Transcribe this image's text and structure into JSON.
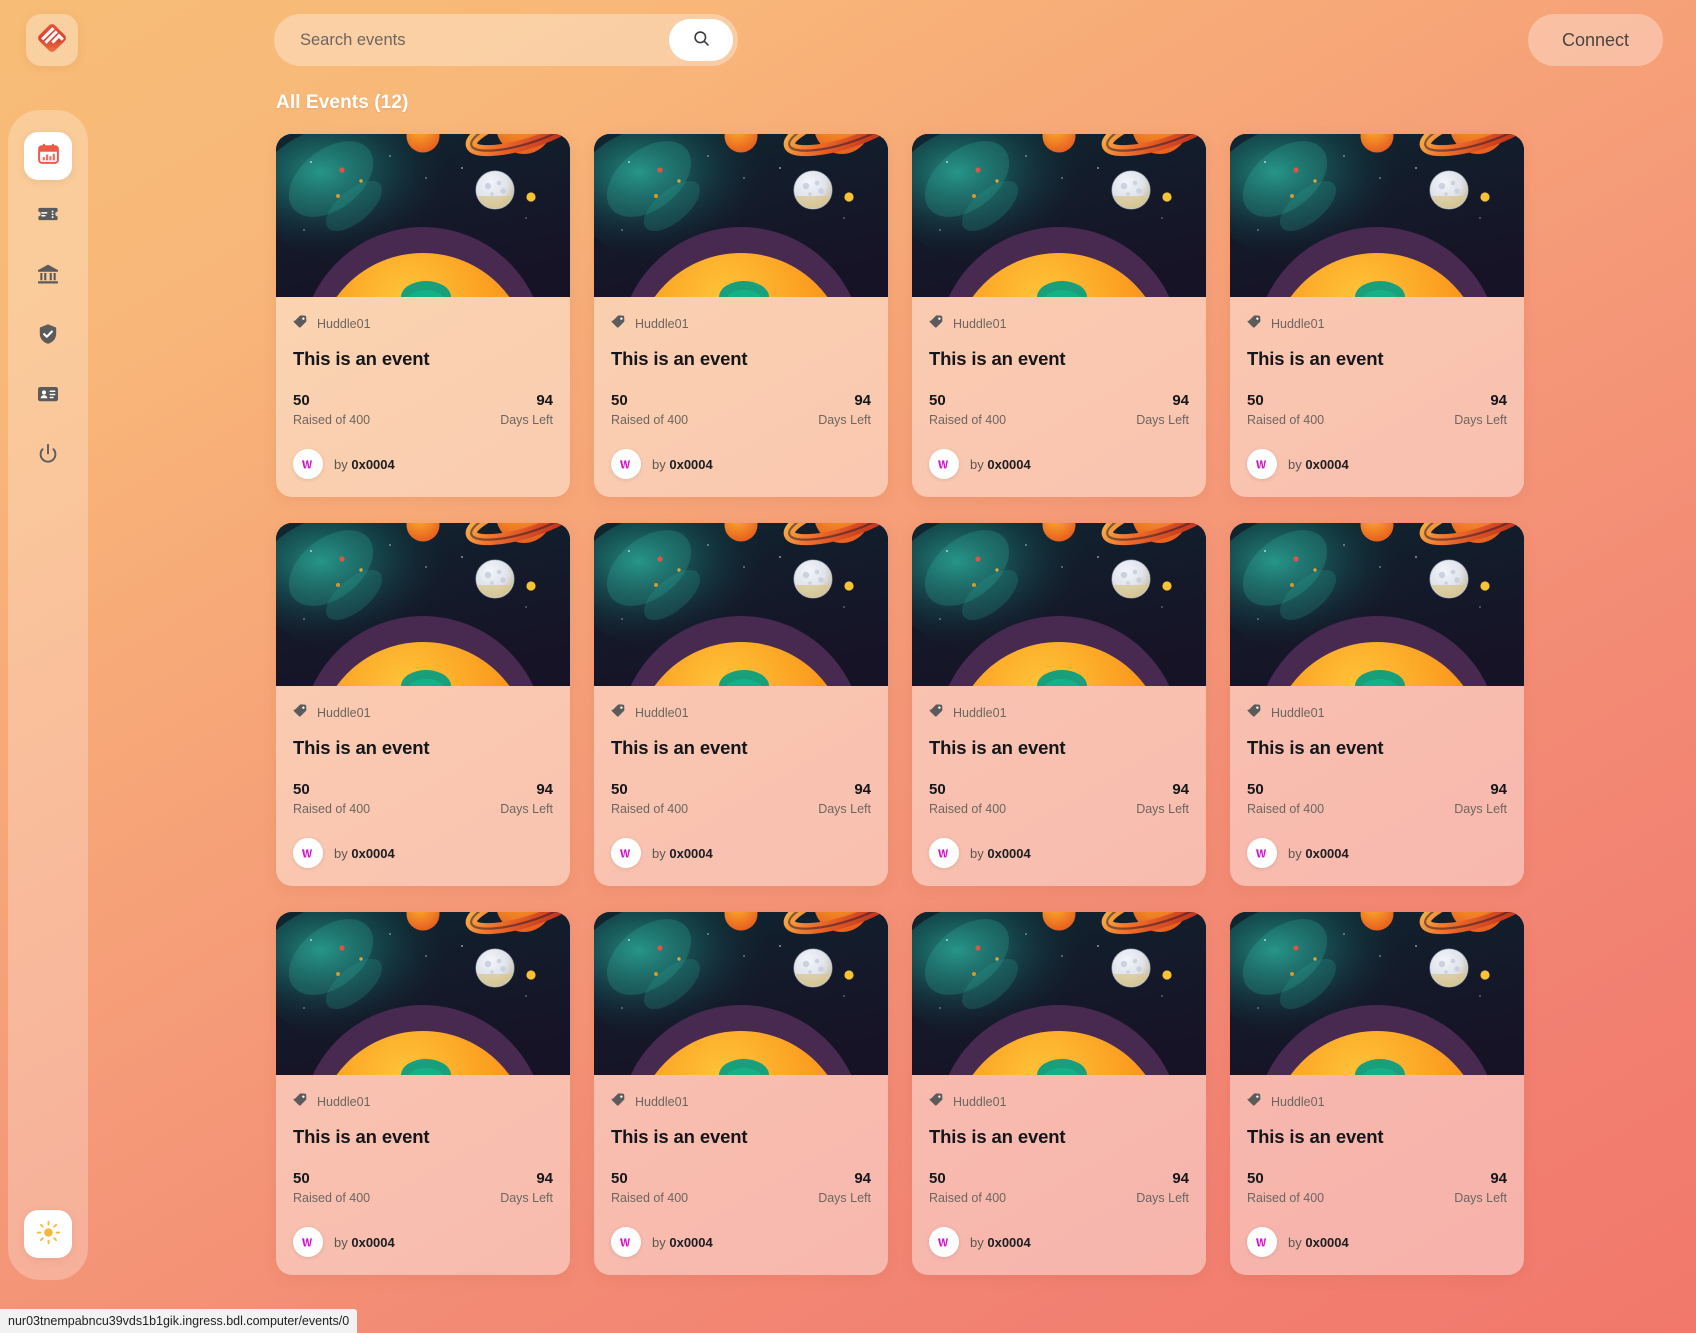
{
  "app": {
    "logo_icon": "app-logo-diamond-icon",
    "accent": "#e3503a",
    "bg_top": "#f7bd76",
    "bg_bottom": "#f1786b"
  },
  "header": {
    "search": {
      "placeholder": "Search events",
      "value": "",
      "button_icon": "search-icon"
    },
    "connect_label": "Connect"
  },
  "sidebar": {
    "items": [
      {
        "icon": "calendar-icon",
        "name": "events",
        "active": true
      },
      {
        "icon": "ticket-icon",
        "name": "tickets",
        "active": false
      },
      {
        "icon": "bank-icon",
        "name": "treasury",
        "active": false
      },
      {
        "icon": "shield-check-icon",
        "name": "verification",
        "active": false
      },
      {
        "icon": "id-card-icon",
        "name": "profile",
        "active": false
      },
      {
        "icon": "power-icon",
        "name": "logout",
        "active": false
      }
    ],
    "theme_toggle_icon": "sun-icon"
  },
  "main": {
    "page_title": "All Events (12)",
    "stat_labels": {
      "raised": "Raised of 400",
      "days": "Days Left"
    },
    "cards": [
      {
        "tag": "Huddle01",
        "title": "This is an event",
        "raised": "50",
        "raised_label": "Raised of 400",
        "days": "94",
        "days_label": "Days Left",
        "author_prefix": "by",
        "author": "0x0004"
      },
      {
        "tag": "Huddle01",
        "title": "This is an event",
        "raised": "50",
        "raised_label": "Raised of 400",
        "days": "94",
        "days_label": "Days Left",
        "author_prefix": "by",
        "author": "0x0004"
      },
      {
        "tag": "Huddle01",
        "title": "This is an event",
        "raised": "50",
        "raised_label": "Raised of 400",
        "days": "94",
        "days_label": "Days Left",
        "author_prefix": "by",
        "author": "0x0004"
      },
      {
        "tag": "Huddle01",
        "title": "This is an event",
        "raised": "50",
        "raised_label": "Raised of 400",
        "days": "94",
        "days_label": "Days Left",
        "author_prefix": "by",
        "author": "0x0004"
      },
      {
        "tag": "Huddle01",
        "title": "This is an event",
        "raised": "50",
        "raised_label": "Raised of 400",
        "days": "94",
        "days_label": "Days Left",
        "author_prefix": "by",
        "author": "0x0004"
      },
      {
        "tag": "Huddle01",
        "title": "This is an event",
        "raised": "50",
        "raised_label": "Raised of 400",
        "days": "94",
        "days_label": "Days Left",
        "author_prefix": "by",
        "author": "0x0004"
      },
      {
        "tag": "Huddle01",
        "title": "This is an event",
        "raised": "50",
        "raised_label": "Raised of 400",
        "days": "94",
        "days_label": "Days Left",
        "author_prefix": "by",
        "author": "0x0004"
      },
      {
        "tag": "Huddle01",
        "title": "This is an event",
        "raised": "50",
        "raised_label": "Raised of 400",
        "days": "94",
        "days_label": "Days Left",
        "author_prefix": "by",
        "author": "0x0004"
      },
      {
        "tag": "Huddle01",
        "title": "This is an event",
        "raised": "50",
        "raised_label": "Raised of 400",
        "days": "94",
        "days_label": "Days Left",
        "author_prefix": "by",
        "author": "0x0004"
      },
      {
        "tag": "Huddle01",
        "title": "This is an event",
        "raised": "50",
        "raised_label": "Raised of 400",
        "days": "94",
        "days_label": "Days Left",
        "author_prefix": "by",
        "author": "0x0004"
      },
      {
        "tag": "Huddle01",
        "title": "This is an event",
        "raised": "50",
        "raised_label": "Raised of 400",
        "days": "94",
        "days_label": "Days Left",
        "author_prefix": "by",
        "author": "0x0004"
      },
      {
        "tag": "Huddle01",
        "title": "This is an event",
        "raised": "50",
        "raised_label": "Raised of 400",
        "days": "94",
        "days_label": "Days Left",
        "author_prefix": "by",
        "author": "0x0004"
      }
    ]
  },
  "statusbar": {
    "url": "nur03tnempabncu39vds1b1gik.ingress.bdl.computer/events/0"
  }
}
